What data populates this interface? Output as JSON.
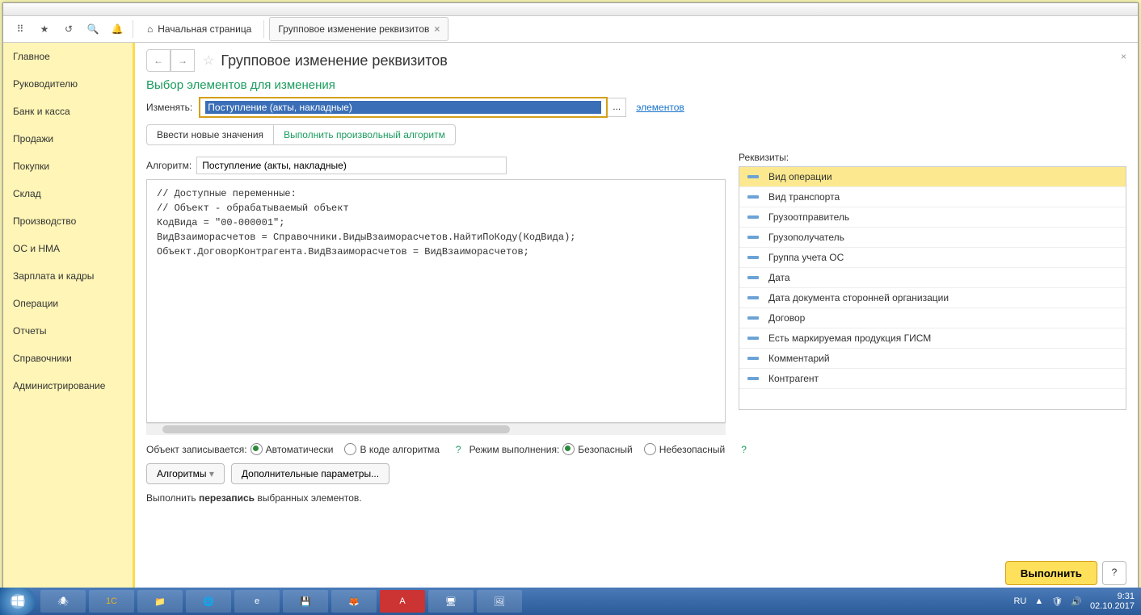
{
  "toolbar": {
    "home_tab": "Начальная страница",
    "active_tab": "Групповое изменение реквизитов"
  },
  "sidebar": {
    "items": [
      "Главное",
      "Руководителю",
      "Банк и касса",
      "Продажи",
      "Покупки",
      "Склад",
      "Производство",
      "ОС и НМА",
      "Зарплата и кадры",
      "Операции",
      "Отчеты",
      "Справочники",
      "Администрирование"
    ]
  },
  "page": {
    "title": "Групповое изменение реквизитов",
    "section": "Выбор элементов для изменения",
    "change_label": "Изменять:",
    "change_value": "Поступление (акты, накладные)",
    "elements_link": "элементов",
    "tab1": "Ввести новые значения",
    "tab2": "Выполнить произвольный алгоритм",
    "algo_label": "Алгоритм:",
    "algo_value": "Поступление (акты, накладные)",
    "code": "// Доступные переменные:\n// Объект - обрабатываемый объект\nКодВида = \"00-000001\";\nВидВзаиморасчетов = Справочники.ВидыВзаиморасчетов.НайтиПоКоду(КодВида);\nОбъект.ДоговорКонтрагента.ВидВзаиморасчетов = ВидВзаиморасчетов;",
    "req_label": "Реквизиты:",
    "req_items": [
      "Вид операции",
      "Вид транспорта",
      "Грузоотправитель",
      "Грузополучатель",
      "Группа учета ОС",
      "Дата",
      "Дата документа сторонней организации",
      "Договор",
      "Есть маркируемая продукция ГИСМ",
      "Комментарий",
      "Контрагент"
    ],
    "obj_write_label": "Объект записывается:",
    "radio_auto": "Автоматически",
    "radio_code": "В коде алгоритма",
    "exec_mode_label": "Режим выполнения:",
    "radio_safe": "Безопасный",
    "radio_unsafe": "Небезопасный",
    "algo_btn": "Алгоритмы",
    "params_btn": "Дополнительные параметры...",
    "footer_pre": "Выполнить ",
    "footer_bold": "перезапись",
    "footer_post": " выбранных элементов.",
    "execute_btn": "Выполнить",
    "help_btn": "?"
  },
  "taskbar": {
    "lang": "RU",
    "time": "9:31",
    "date": "02.10.2017"
  }
}
